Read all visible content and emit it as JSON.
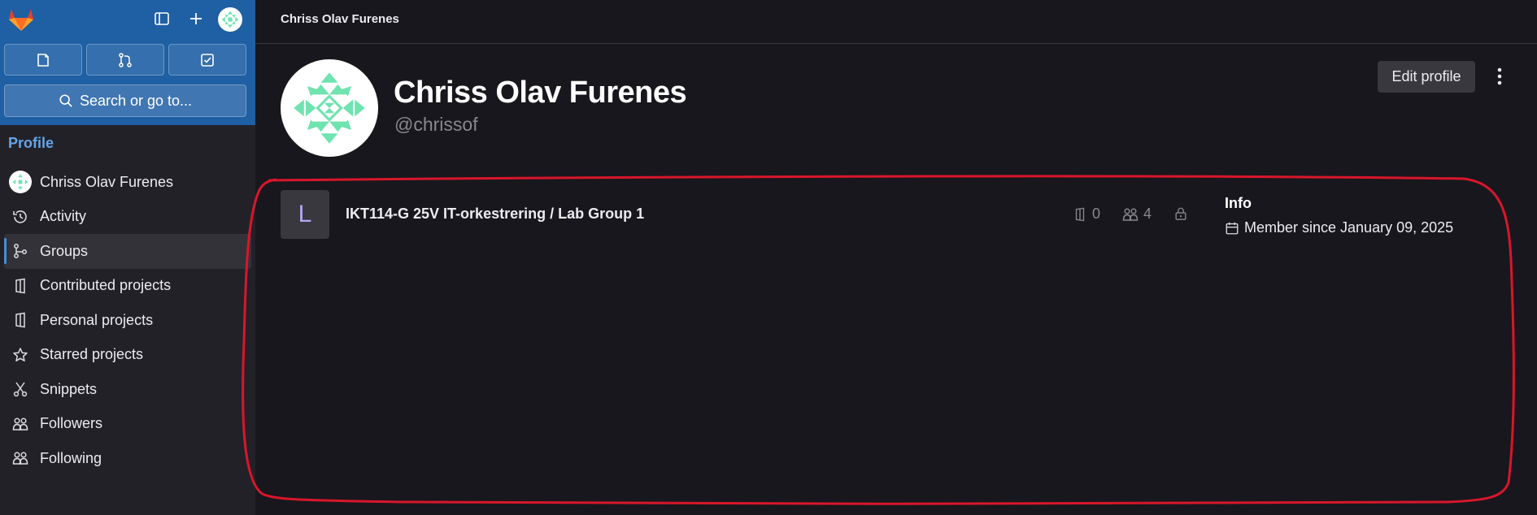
{
  "sidebar": {
    "search_label": "Search or go to...",
    "section_title": "Profile",
    "items": [
      {
        "label": "Chriss Olav Furenes",
        "icon": "user-avatar"
      },
      {
        "label": "Activity",
        "icon": "history-icon"
      },
      {
        "label": "Groups",
        "icon": "group-icon",
        "active": true
      },
      {
        "label": "Contributed projects",
        "icon": "project-icon"
      },
      {
        "label": "Personal projects",
        "icon": "project-icon"
      },
      {
        "label": "Starred projects",
        "icon": "star-icon"
      },
      {
        "label": "Snippets",
        "icon": "scissors-icon"
      },
      {
        "label": "Followers",
        "icon": "users-icon"
      },
      {
        "label": "Following",
        "icon": "users-icon"
      }
    ]
  },
  "header": {
    "breadcrumb": "Chriss Olav Furenes"
  },
  "profile": {
    "name": "Chriss Olav Furenes",
    "username": "@chrissof",
    "edit_label": "Edit profile"
  },
  "groups": [
    {
      "avatar_letter": "L",
      "name": "IKT114-G 25V IT-orkestrering / Lab Group 1",
      "projects": "0",
      "members": "4",
      "visibility": "private"
    }
  ],
  "info": {
    "title": "Info",
    "member_since": "Member since January 09, 2025"
  },
  "colors": {
    "sidebar_top": "#1f5fa4",
    "accent_blue": "#63a6e9",
    "annotation": "#d9162b",
    "identicon": "#6fe3b0"
  }
}
